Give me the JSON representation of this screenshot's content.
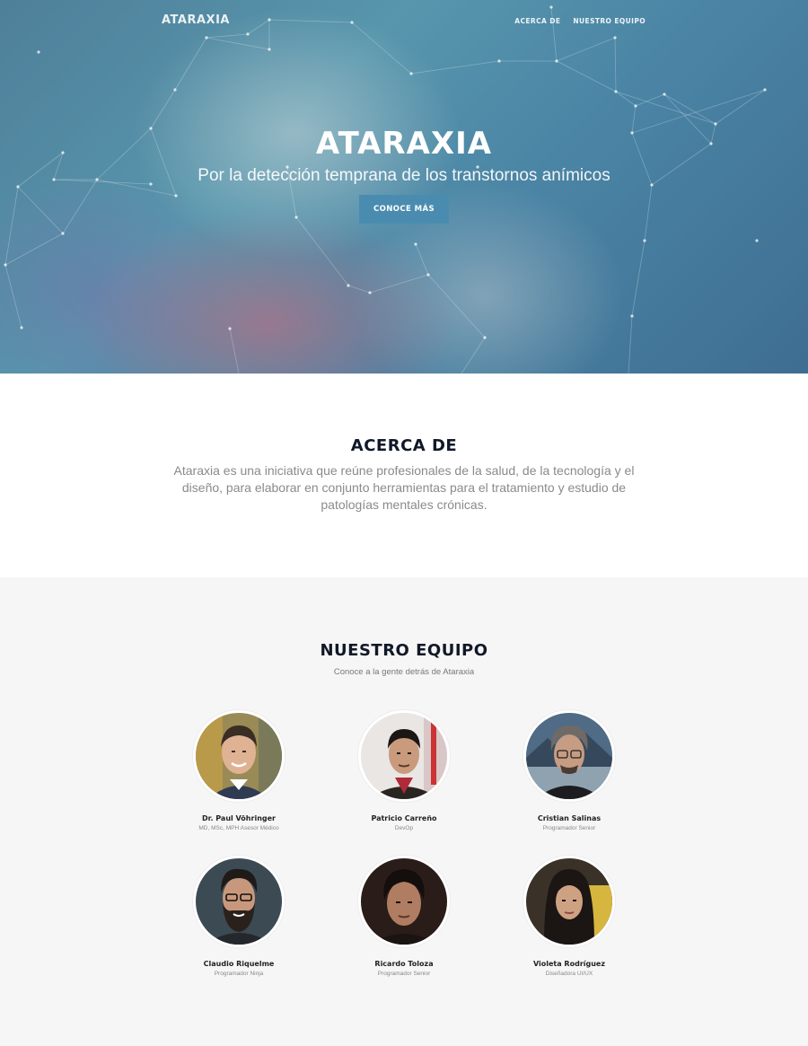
{
  "nav": {
    "logo": "ATARAXIA",
    "links": [
      "ACERCA DE",
      "NUESTRO EQUIPO"
    ]
  },
  "hero": {
    "title": "ATARAXIA",
    "subtitle": "Por la detección temprana de los transtornos anímicos",
    "button": "CONOCE MÁS"
  },
  "about": {
    "title": "ACERCA DE",
    "text": "Ataraxia es una iniciativa que reúne profesionales de la salud, de la tecnología y el diseño, para elaborar en conjunto herramientas para el tratamiento y estudio de patologías mentales crónicas."
  },
  "team": {
    "title": "NUESTRO EQUIPO",
    "subtitle": "Conoce a la gente detrás de Ataraxia",
    "members": [
      {
        "name": "Dr. Paul Vöhringer",
        "role": "MD, MSc, MPH Asesor Médico"
      },
      {
        "name": "Patricio Carreño",
        "role": "DevOp"
      },
      {
        "name": "Cristian Salinas",
        "role": "Programador Senior"
      },
      {
        "name": "Claudio Riquelme",
        "role": "Programador Ninja"
      },
      {
        "name": "Ricardo Toloza",
        "role": "Programador Senior"
      },
      {
        "name": "Violeta Rodríguez",
        "role": "Diseñadora UI/UX"
      }
    ]
  },
  "colors": {
    "accent_button": "#4a8cb0",
    "heading": "#111827",
    "team_background": "#f6f6f6"
  }
}
